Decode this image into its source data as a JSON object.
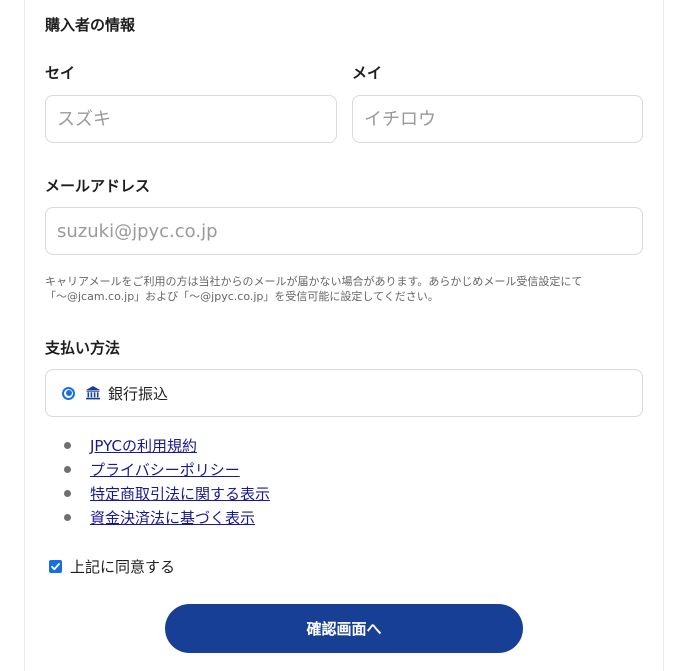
{
  "buyer": {
    "section_title": "購入者の情報",
    "sei_label": "セイ",
    "sei_placeholder": "スズキ",
    "mei_label": "メイ",
    "mei_placeholder": "イチロウ",
    "email_label": "メールアドレス",
    "email_placeholder": "suzuki@jpyc.co.jp",
    "note_line1": "キャリアメールをご利用の方は当社からのメールが届かない場合があります。あらかじめメール受信設定にて",
    "note_line2": "「～@jcam.co.jp」および「～@jpyc.co.jp」を受信可能に設定してください。"
  },
  "payment": {
    "section_title": "支払い方法",
    "selected_option": "銀行振込",
    "option_icon": "bank-icon"
  },
  "links": [
    "JPYCの利用規約",
    "プライバシーポリシー",
    "特定商取引法に関する表示",
    "資金決済法に基づく表示"
  ],
  "agreement": {
    "label": "上記に同意する",
    "checked": true
  },
  "submit_label": "確認画面へ",
  "colors": {
    "primary_button": "#173f95",
    "link": "#1a1a8c",
    "radio_checkbox": "#1a6fe0"
  }
}
